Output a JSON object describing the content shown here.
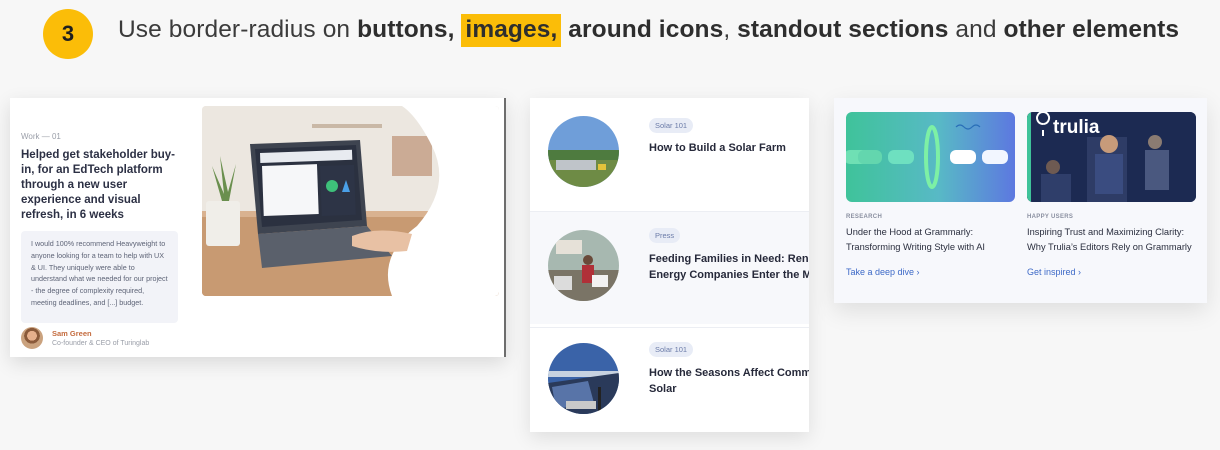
{
  "header": {
    "step_number": "3",
    "text_1": "Use border-radius on ",
    "bold_buttons": "buttons,",
    "highlight_images": "images,",
    "bold_icons": "around icons",
    "text_2": ", ",
    "bold_sections": "standout sections",
    "text_3": " and ",
    "bold_other": "other elements"
  },
  "case_study": {
    "eyebrow": "Work — 01",
    "title": "Helped get stakeholder buy-in, for an EdTech platform through a new user experience and visual refresh, in 6 weeks",
    "quote": "I would 100% recommend Heavyweight to anyone looking for a team to help with UX & UI. They uniquely were able to understand what we needed for our project - the degree of complexity required, meeting deadlines, and [...] budget.",
    "author_name": "Sam Green",
    "author_role": "Co-founder & CEO of Turinglab"
  },
  "articles": [
    {
      "tag": "Solar 101",
      "title": "How to Build a Solar Farm"
    },
    {
      "tag": "Press",
      "title_line1": "Feeding Families in Need: Ren",
      "title_line2": "Energy Companies Enter the M"
    },
    {
      "tag": "Solar 101",
      "title_line1": "How the Seasons Affect Comm",
      "title_line2": "Solar"
    }
  ],
  "blog": [
    {
      "eyebrow": "RESEARCH",
      "title": "Under the Hood at Grammarly: Transforming Writing Style with AI",
      "link": "Take a deep dive ›"
    },
    {
      "eyebrow": "HAPPY USERS",
      "title": "Inspiring Trust and Maximizing Clarity: Why Trulia’s Editors Rely on Grammarly",
      "link": "Get inspired ›",
      "logo_text": "trulia"
    }
  ],
  "colors": {
    "accent_yellow": "#fbbd08",
    "link_blue": "#3d69c7",
    "grammarly_green": "#3fc39a",
    "trulia_navy": "#1c2a52"
  }
}
